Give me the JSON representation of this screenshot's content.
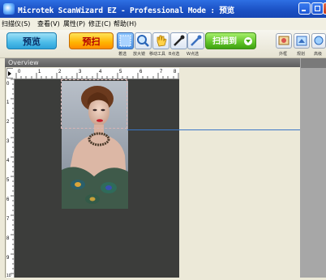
{
  "window": {
    "title": "Microtek ScanWizard EZ - Professional Mode : 预览"
  },
  "menu": [
    "扫描仪(S)",
    "查看(V)",
    "属性(P)",
    "修正(C)",
    "帮助(H)"
  ],
  "toolbar": {
    "preview_label": "预览",
    "scan_label": "预扫",
    "tools": [
      {
        "icon": "select-tool-icon",
        "label": "着选"
      },
      {
        "icon": "magnifier-icon",
        "label": "放大镜"
      },
      {
        "icon": "hand-move-icon",
        "label": "移动工具"
      },
      {
        "icon": "black-point-eyedropper-icon",
        "label": "B点选"
      },
      {
        "icon": "white-point-eyedropper-icon",
        "label": "W点选"
      }
    ],
    "scan_to_label": "扫描到",
    "right_tools": [
      {
        "icon": "frame-icon",
        "label": "外框"
      },
      {
        "icon": "settings-icon",
        "label": "规划"
      },
      {
        "icon": "advanced-icon",
        "label": "高级"
      }
    ]
  },
  "panel": {
    "title": "Overview",
    "ruler_h": [
      "0",
      "1",
      "2",
      "3",
      "4",
      "5",
      "6",
      "7",
      "8"
    ],
    "ruler_v": [
      "0",
      "1",
      "2",
      "3",
      "4",
      "5",
      "6",
      "7",
      "8",
      "9",
      "10"
    ]
  },
  "colors": {
    "titlebar": "#1a4fc2",
    "scan_bed": "#3c3d3b",
    "preview_button": "#4bbbe8",
    "scan_button": "#ffb400",
    "scan_to_button": "#5fc228",
    "guide_line": "#3a76c6"
  }
}
